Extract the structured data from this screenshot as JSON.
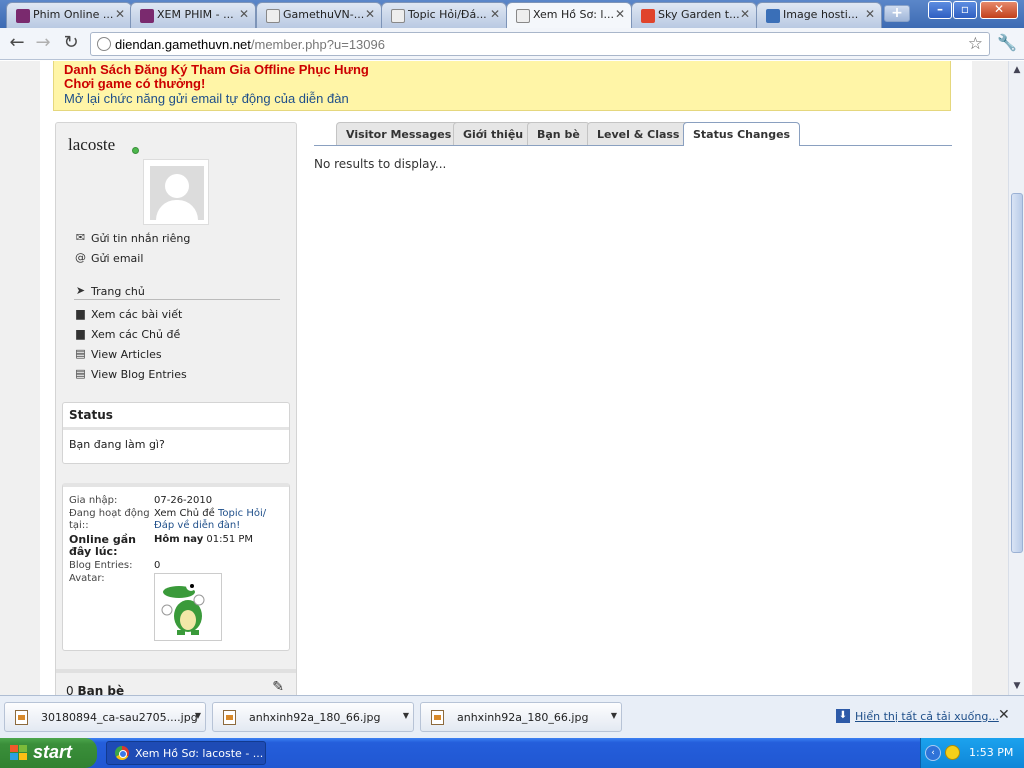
{
  "browser": {
    "tabs": [
      {
        "label": "Phim Online ...",
        "favicon": "film-icon",
        "color": "#7a2a6e",
        "active": false
      },
      {
        "label": "XEM PHIM - ...",
        "favicon": "film-icon",
        "color": "#7a2a6e",
        "active": false
      },
      {
        "label": "GamethuVN-...",
        "favicon": "page-icon",
        "color": "#8b8b8b",
        "active": false
      },
      {
        "label": "Topic Hỏi/Đá...",
        "favicon": "page-icon",
        "color": "#8b8b8b",
        "active": false
      },
      {
        "label": "Xem Hồ Sơ: l...",
        "favicon": "page-icon",
        "color": "#8b8b8b",
        "active": true
      },
      {
        "label": "Sky Garden t...",
        "favicon": "z-icon",
        "color": "#e0442b",
        "active": false
      },
      {
        "label": "Image hosti...",
        "favicon": "image-icon",
        "color": "#3a6fb8",
        "active": false
      }
    ],
    "url_host": "diendan.gamethuvn.net",
    "url_path": "/member.php?u=13096"
  },
  "notice": {
    "line1": "Danh Sách Đăng Ký Tham Gia Offline Phục Hưng",
    "line2": "Chơi game có thưởng!",
    "line3": "Mở lại chức năng gửi email tự động của diễn đàn"
  },
  "profile": {
    "username": "lacoste",
    "links": [
      {
        "label": "Gửi tin nhắn riêng",
        "icon": "envelope-icon"
      },
      {
        "label": "Gửi email",
        "icon": "at-icon"
      },
      {
        "label": "Trang chủ",
        "icon": "cursor-icon"
      },
      {
        "label": "Xem các bài viết",
        "icon": "posts-icon"
      },
      {
        "label": "Xem các Chủ đề",
        "icon": "threads-icon"
      },
      {
        "label": "View Articles",
        "icon": "articles-icon"
      },
      {
        "label": "View Blog Entries",
        "icon": "blog-icon"
      }
    ],
    "status_title": "Status",
    "status_prompt": "Bạn đang làm gì?",
    "info": {
      "join_label": "Gia nhập:",
      "join_value": "07-26-2010",
      "activity_label": "Đang hoạt động tại::",
      "activity_prefix": "Xem Chủ đề",
      "activity_link": "Topic Hỏi/Đáp về diễn đàn!",
      "online_label": "Online gần đây lúc:",
      "online_day": "Hôm nay",
      "online_time": "01:51 PM",
      "blog_label": "Blog Entries:",
      "blog_value": "0",
      "avatar_label": "Avatar:"
    },
    "friends_count": "0",
    "friends_label": "Bạn bè"
  },
  "main": {
    "tabs": [
      "Visitor Messages",
      "Giới thiệu",
      "Bạn bè",
      "Level & Class",
      "Status Changes"
    ],
    "selected_tab": "Status Changes",
    "no_results": "No results to display..."
  },
  "downloads": {
    "items": [
      "30180894_ca-sau2705....jpg",
      "anhxinh92a_180_66.jpg",
      "anhxinh92a_180_66.jpg"
    ],
    "show_all": "Hiển thị tất cả tải xuống..."
  },
  "taskbar": {
    "start_label": "start",
    "task_label": "Xem Hồ Sơ: lacoste - ...",
    "clock": "1:53 PM"
  }
}
